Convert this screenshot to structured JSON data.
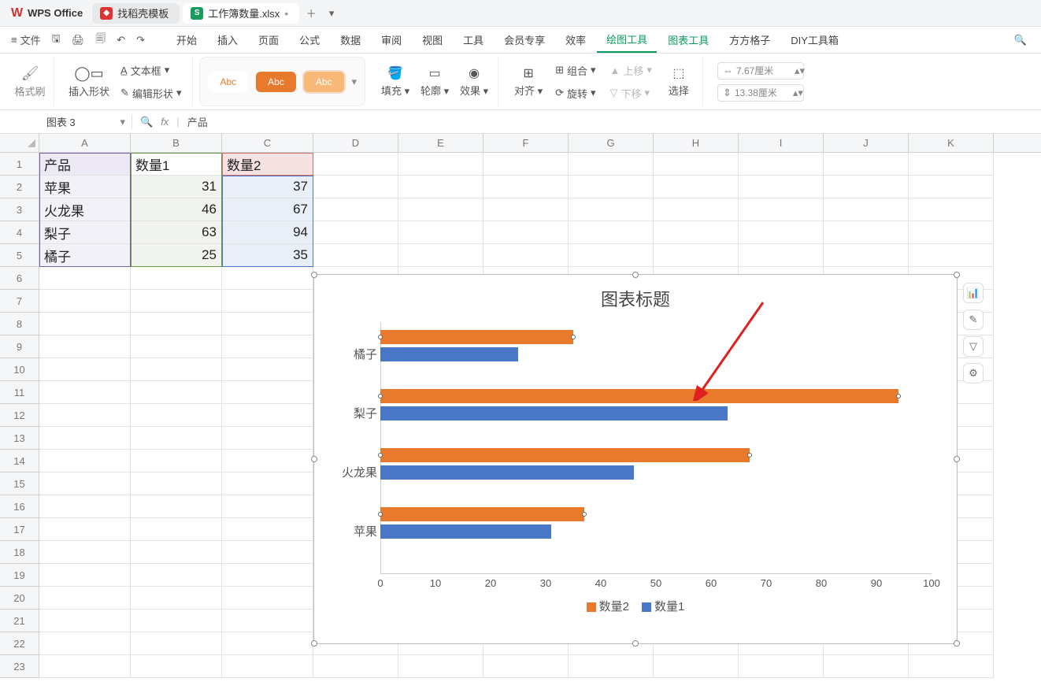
{
  "app": {
    "name": "WPS Office"
  },
  "tabs": [
    {
      "label": "找稻壳模板",
      "icon_bg": "#d33",
      "icon_text": ""
    },
    {
      "label": "工作簿数量.xlsx",
      "icon_bg": "#1a9b5e",
      "icon_text": "S",
      "dirty": "•",
      "active": true
    }
  ],
  "menu": {
    "file": "文件",
    "items": [
      "开始",
      "插入",
      "页面",
      "公式",
      "数据",
      "审阅",
      "视图",
      "工具",
      "会员专享",
      "效率",
      "绘图工具",
      "图表工具",
      "方方格子",
      "DIY工具箱"
    ]
  },
  "ribbon": {
    "format_brush": "格式刷",
    "insert_shape": "插入形状",
    "text_box": "文本框",
    "edit_shape": "编辑形状",
    "abc": [
      "Abc",
      "Abc",
      "Abc"
    ],
    "fill": "填充",
    "outline": "轮廓",
    "effect": "效果",
    "align": "对齐",
    "group": "组合",
    "rotate": "旋转",
    "up": "上移",
    "down": "下移",
    "select": "选择",
    "width_val": "7.67厘米",
    "height_val": "13.38厘米"
  },
  "formula": {
    "namebox": "图表 3",
    "fx_label": "fx",
    "value": "产品"
  },
  "columns": [
    "A",
    "B",
    "C",
    "D",
    "E",
    "F",
    "G",
    "H",
    "I",
    "J",
    "K"
  ],
  "rowcount": 23,
  "table": {
    "headers": [
      "产品",
      "数量1",
      "数量2"
    ],
    "rows": [
      [
        "苹果",
        "31",
        "37"
      ],
      [
        "火龙果",
        "46",
        "67"
      ],
      [
        "梨子",
        "63",
        "94"
      ],
      [
        "橘子",
        "25",
        "35"
      ]
    ]
  },
  "chart_data": {
    "type": "bar",
    "title": "图表标题",
    "categories": [
      "橘子",
      "梨子",
      "火龙果",
      "苹果"
    ],
    "series": [
      {
        "name": "数量2",
        "values": [
          35,
          94,
          67,
          37
        ],
        "color": "#e87a2e"
      },
      {
        "name": "数量1",
        "values": [
          25,
          63,
          46,
          31
        ],
        "color": "#4a78c8"
      }
    ],
    "xlim": [
      0,
      100
    ],
    "xticks": [
      0,
      10,
      20,
      30,
      40,
      50,
      60,
      70,
      80,
      90,
      100
    ],
    "xlabel": "",
    "ylabel": ""
  },
  "side_buttons": [
    "chart-elements",
    "chart-style",
    "chart-filter",
    "chart-settings"
  ]
}
